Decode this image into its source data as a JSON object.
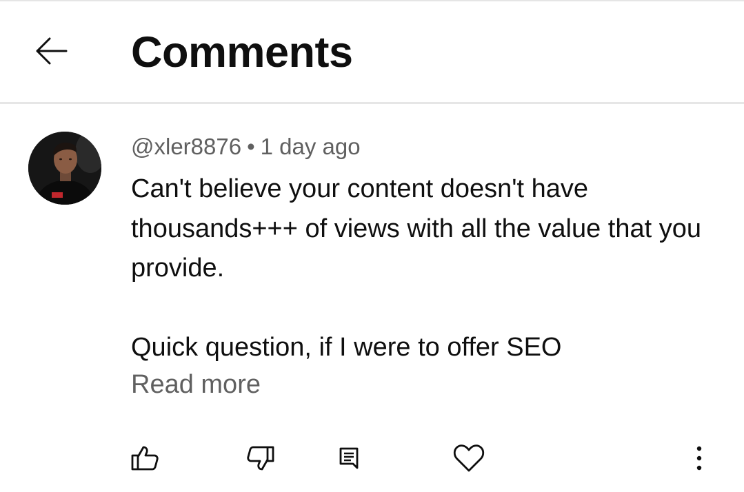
{
  "header": {
    "title": "Comments",
    "back_icon": "arrow-left-icon"
  },
  "comment": {
    "author": "@xler8876",
    "separator": "•",
    "time": "1 day ago",
    "text": "Can't believe your content doesn't have thousands+++ of views with all the value that you provide.\n\nQuick question, if I were to offer SEO",
    "read_more": "Read more"
  },
  "actions": {
    "icons": [
      "thumbs-up-icon",
      "thumbs-down-icon",
      "reply-icon",
      "heart-icon",
      "more-vert-icon"
    ]
  },
  "colors": {
    "text_primary": "#0f0f0f",
    "text_secondary": "#606060",
    "divider": "#e6e6e6",
    "background": "#ffffff"
  }
}
